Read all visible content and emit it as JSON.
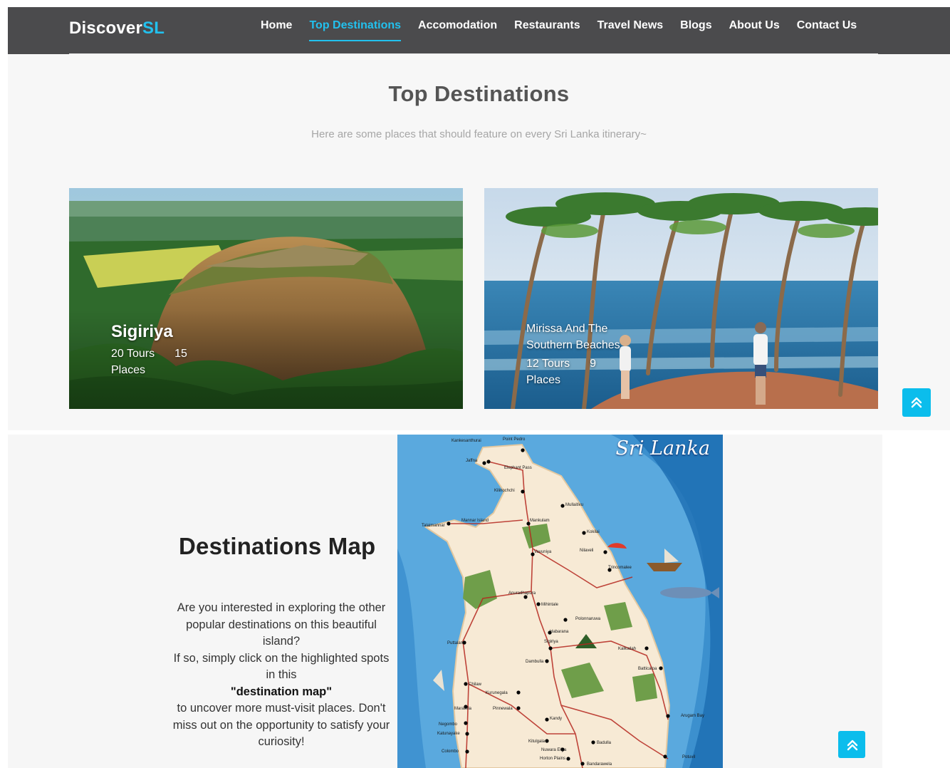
{
  "header": {
    "brand_main": "Discover",
    "brand_accent": "SL",
    "nav": [
      {
        "label": "Home"
      },
      {
        "label": "Top Destinations",
        "active": true
      },
      {
        "label": "Accomodation"
      },
      {
        "label": "Restaurants"
      },
      {
        "label": "Travel News"
      },
      {
        "label": "Blogs"
      },
      {
        "label": "About Us"
      },
      {
        "label": "Contact Us"
      }
    ]
  },
  "top_destinations": {
    "title": "Top Destinations",
    "subtitle": "Here are some places that should feature on every Sri Lanka itinerary~",
    "cards": [
      {
        "title": "Sigiriya",
        "tours_label": "20 Tours",
        "places_count": "15",
        "places_label": "Places"
      },
      {
        "title": "Mirissa And The Southern Beaches",
        "tours_label": "12 Tours",
        "places_count": "9",
        "places_label": "Places"
      }
    ]
  },
  "map_section": {
    "title": "Destinations Map",
    "paragraph_1": "Are you interested in exploring the other popular destinations on this beautiful island?",
    "paragraph_2": "If so, simply click on the highlighted spots in this",
    "highlight": "\"destination map\"",
    "paragraph_3": "to uncover more must-visit places. Don't miss out on the opportunity to satisfy your curiosity!",
    "map_brand": "Sri Lanka",
    "places": [
      "Kankesanthurai",
      "Point Pedro",
      "Jaffna",
      "Elephant Pass",
      "Kilinochchi",
      "Mullaitivu",
      "Talaimannar",
      "Mannar Island",
      "Mankulam",
      "Kokilai",
      "Vavuniya",
      "Nilaveli",
      "Trincomalee",
      "Anuradhapura",
      "Mihintale",
      "Polonnaruwa",
      "Habarana",
      "Puttalam",
      "Sigiriya",
      "Kalkudah",
      "Dambulla",
      "Batticaloa",
      "Chilaw",
      "Kurunegala",
      "Pinnewala",
      "Marawila",
      "Negombo",
      "Katunayake",
      "Kandy",
      "Colombo",
      "Arugam Bay",
      "Badulla",
      "Nuwara Eliya",
      "Potuvil",
      "Kitulgala",
      "Horton Plains",
      "Bandarawela"
    ]
  },
  "colors": {
    "nav_bg": "#4b4b4d",
    "accent": "#22c1ee",
    "scroll_button": "#0bbdec"
  },
  "icons": [
    "double-chevron-up-icon"
  ]
}
